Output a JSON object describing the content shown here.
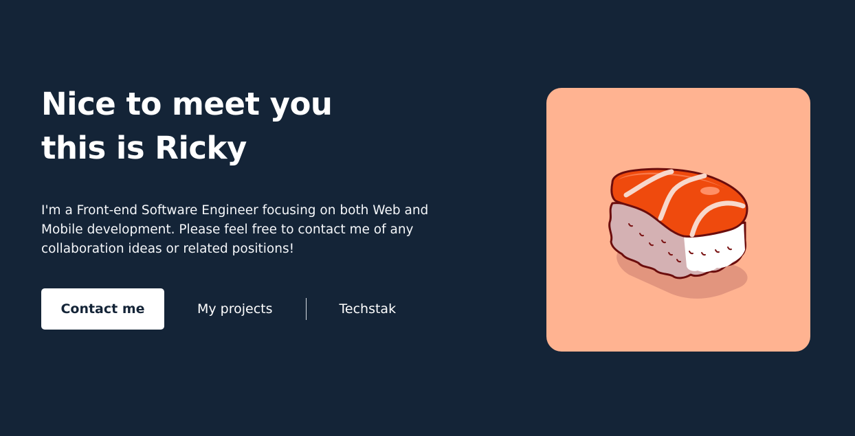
{
  "hero": {
    "title_line_1": "Nice to meet you",
    "title_line_2": "this is Ricky",
    "intro": "I'm a Front-end Software Engineer focusing on both Web and Mobile development. Please feel free to contact me of any collaboration ideas or related positions!"
  },
  "actions": {
    "contact_label": "Contact me",
    "projects_label": "My projects",
    "techstak_label": "Techstak"
  },
  "illustration": {
    "icon": "salmon-sushi-illustration"
  },
  "colors": {
    "background": "#142437",
    "card": "#ffb391",
    "salmon": "#ef4a0d",
    "rice": "#ffffff",
    "outline": "#6b0d0d"
  }
}
